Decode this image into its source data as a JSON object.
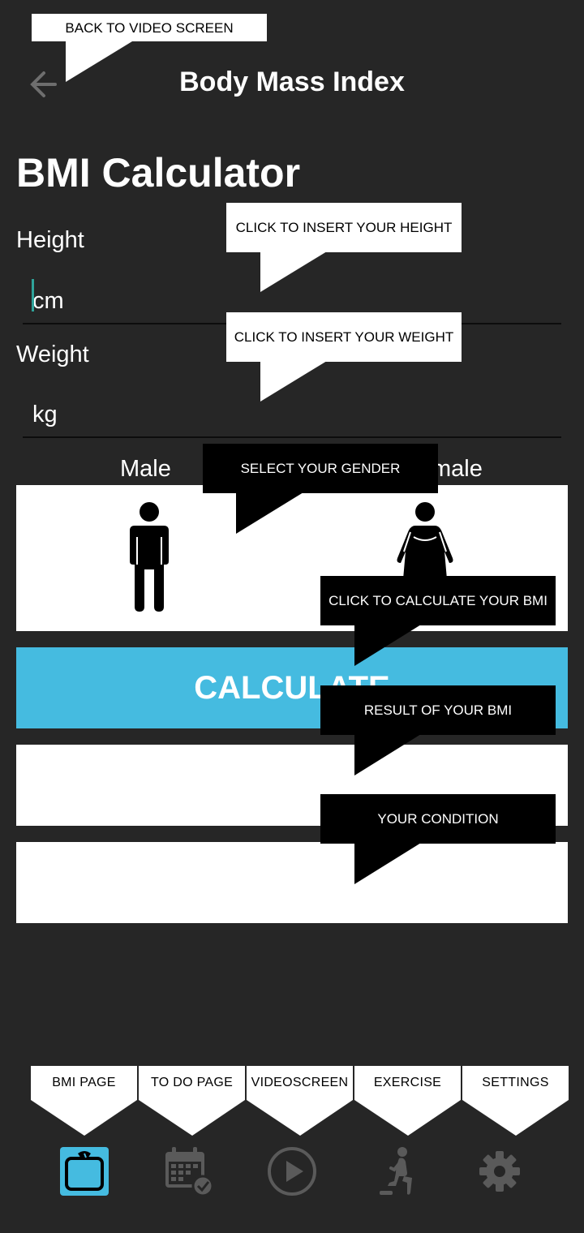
{
  "header": {
    "title": "Body Mass Index",
    "back_icon": "arrow-left-icon"
  },
  "main": {
    "page_title": "BMI Calculator",
    "height": {
      "label": "Height",
      "placeholder": "cm",
      "value": ""
    },
    "weight": {
      "label": "Weight",
      "placeholder": "kg",
      "value": ""
    },
    "gender": {
      "male_label": "Male",
      "female_label_visible": "male",
      "male_icon": "male-figure-icon",
      "female_icon": "female-figure-icon"
    },
    "calculate_label": "CALCULATE",
    "result_value": "",
    "condition_value": ""
  },
  "callouts": {
    "back": "BACK TO VIDEO SCREEN",
    "height": "CLICK TO INSERT YOUR HEIGHT",
    "weight": "CLICK TO INSERT YOUR WEIGHT",
    "gender": "SELECT YOUR GENDER",
    "calculate": "CLICK TO CALCULATE YOUR BMI",
    "result": "RESULT OF YOUR BMI",
    "condition": "YOUR CONDITION"
  },
  "bottom_nav": {
    "labels": [
      "BMI PAGE",
      "TO DO PAGE",
      "VIDEOSCREEN",
      "EXERCISE",
      "SETTINGS"
    ],
    "icons": [
      "scale-icon",
      "calendar-check-icon",
      "play-circle-icon",
      "exercise-lunge-icon",
      "gear-icon"
    ],
    "active_index": 0
  },
  "colors": {
    "background": "#262626",
    "accent": "#45bbe0",
    "cursor": "#2fa39a",
    "inactive_icon": "#5a5a5a"
  }
}
